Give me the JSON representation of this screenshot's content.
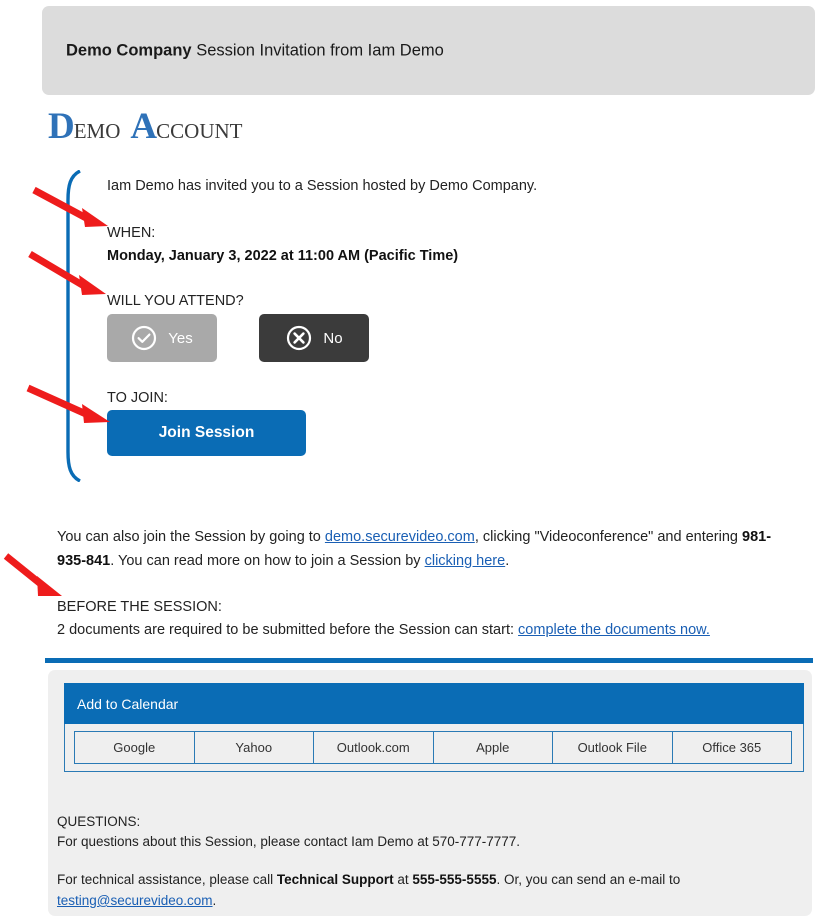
{
  "header": {
    "company": "Demo Company",
    "subject": " Session Invitation from Iam Demo"
  },
  "logo": {
    "word1_cap": "D",
    "word1_rest": "EMO",
    "word2_cap": "A",
    "word2_rest": "CCOUNT"
  },
  "body": {
    "intro": "Iam Demo has invited you to a Session hosted by Demo Company.",
    "when_label": "WHEN:",
    "when_value": "Monday, January 3, 2022 at 11:00 AM (Pacific Time)",
    "attend_label": "WILL YOU ATTEND?",
    "yes_label": "Yes",
    "no_label": "No",
    "yes_icon": "check-circle-icon",
    "no_icon": "x-circle-icon",
    "join_label": "TO JOIN:",
    "join_button": "Join Session"
  },
  "paragraphs": {
    "alsojoin_1": "You can also join the Session by going to ",
    "alsojoin_link1": "demo.securevideo.com",
    "alsojoin_2": ", clicking \"Videoconference\" and entering ",
    "alsojoin_code": "981-935-841",
    "alsojoin_3": ". You can read more on how to join a Session by ",
    "alsojoin_link2": "clicking here",
    "alsojoin_4": ".",
    "before_label": "BEFORE THE SESSION:",
    "before_text": "2 documents are required to be submitted before the Session can start: ",
    "before_link": "complete the documents now."
  },
  "calendar": {
    "title": "Add to Calendar",
    "options": [
      "Google",
      "Yahoo",
      "Outlook.com",
      "Apple",
      "Outlook File",
      "Office 365"
    ]
  },
  "footer": {
    "questions_label": "QUESTIONS:",
    "questions_text": "For questions about this Session, please contact Iam Demo at 570-777-7777.",
    "tech_1": "For technical assistance, please call ",
    "tech_bold": "Technical Support",
    "tech_2": " at ",
    "tech_phone": "555-555-5555",
    "tech_3": ". Or, you can send an e-mail to ",
    "tech_email": "testing@securevideo.com",
    "tech_4": "."
  },
  "colors": {
    "brand_blue": "#0a6cb5",
    "link_blue": "#1a5fb4",
    "header_gray": "#dcdcdc",
    "panel_gray": "#efefef",
    "yes_gray": "#a9a9a9",
    "no_dark": "#3b3b3b",
    "annotation_red": "#ee1c1c"
  }
}
